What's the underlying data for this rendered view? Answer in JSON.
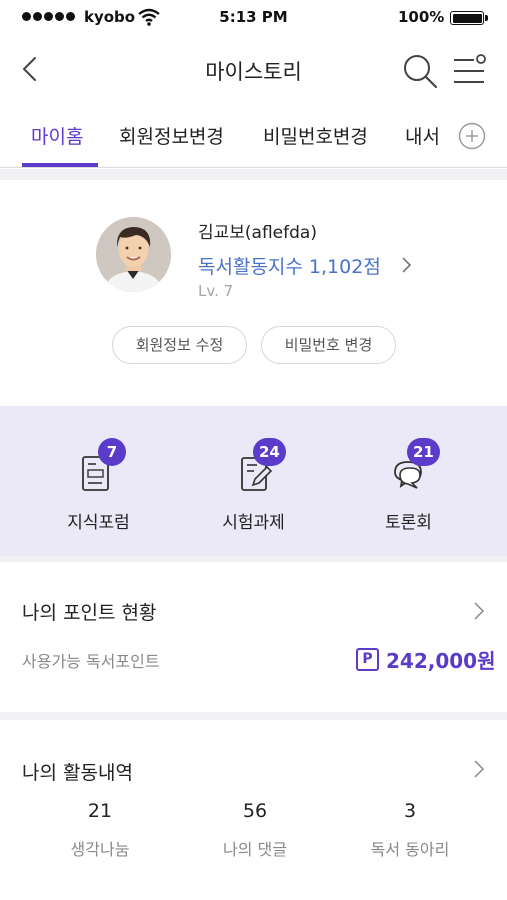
{
  "status_bar": {
    "carrier": "kyobo",
    "time": "5:13 PM",
    "battery": "100%"
  },
  "header": {
    "title": "마이스토리",
    "back_icon": "chevron-left-icon",
    "search_icon": "search-icon",
    "menu_icon": "menu-icon"
  },
  "tabs": [
    {
      "label": "마이홈",
      "active": true
    },
    {
      "label": "회원정보변경",
      "active": false
    },
    {
      "label": "비밀번호변경",
      "active": false
    },
    {
      "label": "내서",
      "active": false
    }
  ],
  "profile": {
    "name": "김교보(aflefda)",
    "reading_index": "독서활동지수 1,102점",
    "level": "Lv. 7",
    "edit_info_button": "회원정보 수정",
    "change_password_button": "비밀번호 변경"
  },
  "activities": [
    {
      "label": "지식포럼",
      "count": "7",
      "icon": "document-icon"
    },
    {
      "label": "시험과제",
      "count": "24",
      "icon": "edit-note-icon"
    },
    {
      "label": "토론회",
      "count": "21",
      "icon": "chat-bubbles-icon"
    }
  ],
  "points": {
    "title": "나의 포인트 현황",
    "label": "사용가능 독서포인트",
    "badge": "P",
    "value": "242,000원"
  },
  "history": {
    "title": "나의 활동내역",
    "stats": [
      {
        "value": "21",
        "label": "생각나눔"
      },
      {
        "value": "56",
        "label": "나의 댓글"
      },
      {
        "value": "3",
        "label": "독서 동아리"
      }
    ]
  },
  "colors": {
    "accent": "#5b3bc9",
    "link": "#4a73c9",
    "band": "#ebe8f7"
  }
}
